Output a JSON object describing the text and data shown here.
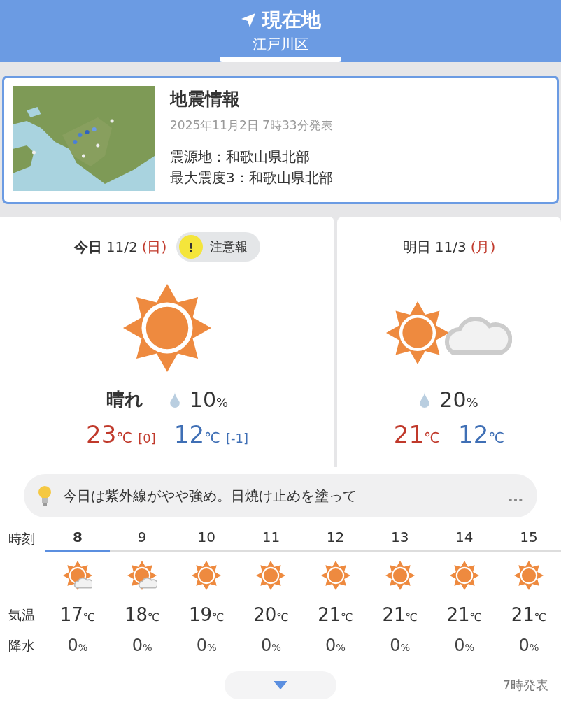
{
  "header": {
    "title": "現在地",
    "subtitle": "江戸川区"
  },
  "quake": {
    "title": "地震情報",
    "published": "2025年11月2日 7時33分発表",
    "lines": [
      "震源地：和歌山県北部",
      "最大震度3：和歌山県北部"
    ]
  },
  "days": [
    {
      "label": "今日",
      "date": "11/2",
      "weekday": "(日)",
      "alert": {
        "icon": "!",
        "label": "注意報"
      },
      "kind": "sunny",
      "weather": "晴れ",
      "rain": {
        "value": "10",
        "unit": "%"
      },
      "high": {
        "value": "23",
        "unit": "℃",
        "diff": "[0]"
      },
      "low": {
        "value": "12",
        "unit": "℃",
        "diff": "[-1]"
      }
    },
    {
      "label": "明日",
      "date": "11/3",
      "weekday": "(月)",
      "kind": "sunny_cloudy",
      "rain": {
        "value": "20",
        "unit": "%"
      },
      "high": {
        "value": "21",
        "unit": "℃"
      },
      "low": {
        "value": "12",
        "unit": "℃"
      }
    }
  ],
  "tip": {
    "text": "今日は紫外線がやや強め。日焼け止めを塗って",
    "more": "…"
  },
  "hourly": {
    "labels": {
      "time": "時刻",
      "temp": "気温",
      "rain": "降水"
    },
    "hours": [
      {
        "hour": "8",
        "selected": true,
        "kind": "sunny_cloudy",
        "temp": "17",
        "unit": "℃",
        "rain": "0",
        "rain_unit": "%"
      },
      {
        "hour": "9",
        "selected": false,
        "kind": "sunny_cloudy",
        "temp": "18",
        "unit": "℃",
        "rain": "0",
        "rain_unit": "%"
      },
      {
        "hour": "10",
        "selected": false,
        "kind": "sunny",
        "temp": "19",
        "unit": "℃",
        "rain": "0",
        "rain_unit": "%"
      },
      {
        "hour": "11",
        "selected": false,
        "kind": "sunny",
        "temp": "20",
        "unit": "℃",
        "rain": "0",
        "rain_unit": "%"
      },
      {
        "hour": "12",
        "selected": false,
        "kind": "sunny",
        "temp": "21",
        "unit": "℃",
        "rain": "0",
        "rain_unit": "%"
      },
      {
        "hour": "13",
        "selected": false,
        "kind": "sunny",
        "temp": "21",
        "unit": "℃",
        "rain": "0",
        "rain_unit": "%"
      },
      {
        "hour": "14",
        "selected": false,
        "kind": "sunny",
        "temp": "21",
        "unit": "℃",
        "rain": "0",
        "rain_unit": "%"
      },
      {
        "hour": "15",
        "selected": false,
        "kind": "sunny",
        "temp": "21",
        "unit": "℃",
        "rain": "0",
        "rain_unit": "%"
      }
    ]
  },
  "footer": {
    "published": "7時発表"
  }
}
